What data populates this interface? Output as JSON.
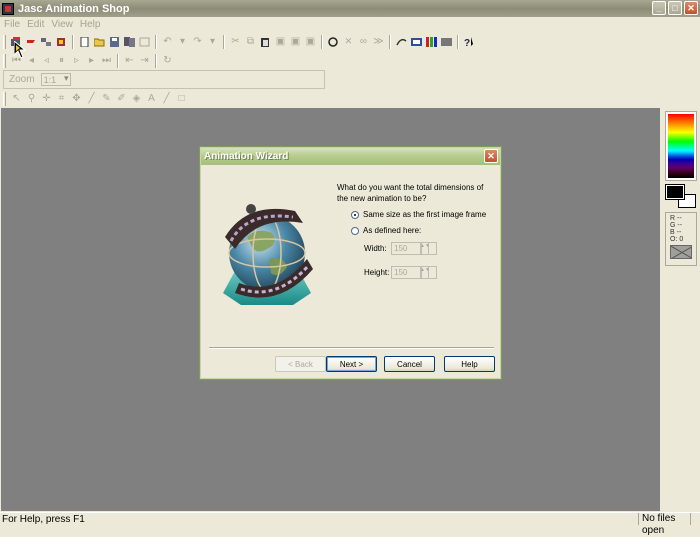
{
  "window": {
    "title": "Jasc Animation Shop",
    "buttons": {
      "minimize": "_",
      "maximize": "□",
      "close": "✕"
    }
  },
  "menu": [
    "File",
    "Edit",
    "View",
    "Help"
  ],
  "zoom": {
    "label": "Zoom",
    "value": "1:1"
  },
  "status": {
    "left": "For Help, press F1",
    "right": "No files open"
  },
  "color_panel": {
    "r": "R --",
    "g": "G --",
    "b": "B --",
    "o": "O: 0"
  },
  "dialog": {
    "title": "Animation Wizard",
    "close": "✕",
    "question": "What do you want the total dimensions of the new animation to be?",
    "option_same": "Same size as the first image frame",
    "option_defined": "As defined here:",
    "width_label": "Width:",
    "width_value": "150",
    "height_label": "Height:",
    "height_value": "150",
    "selected_option": "same",
    "buttons": {
      "back": "< Back",
      "next": "Next >",
      "cancel": "Cancel",
      "help": "Help"
    }
  }
}
